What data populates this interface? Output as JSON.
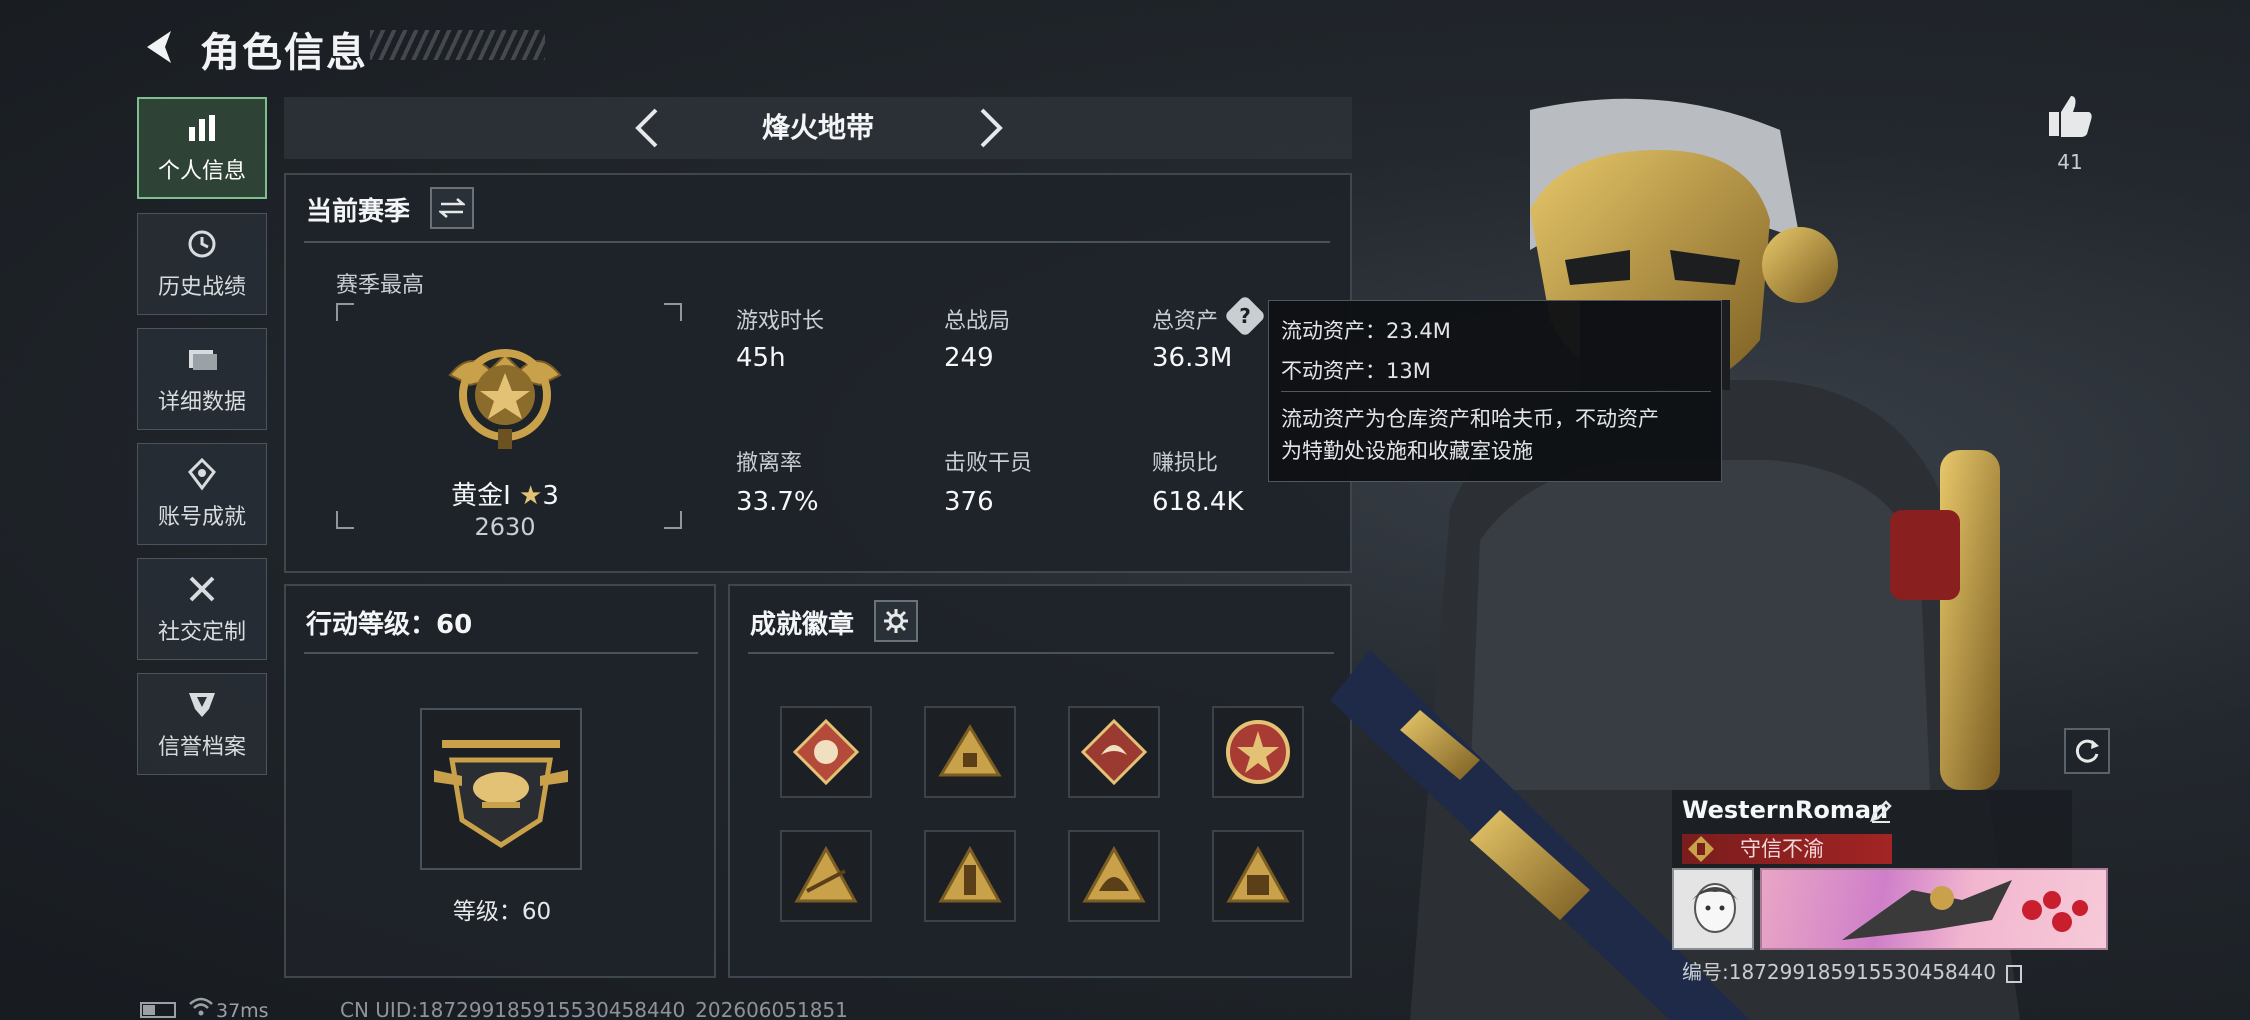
{
  "header": {
    "title": "角色信息"
  },
  "sidebar": {
    "items": [
      {
        "label": "个人信息",
        "icon": "bar-chart-icon",
        "active": true
      },
      {
        "label": "历史战绩",
        "icon": "history-clock-icon",
        "active": false
      },
      {
        "label": "详细数据",
        "icon": "folder-icon",
        "active": false
      },
      {
        "label": "账号成就",
        "icon": "achievement-icon",
        "active": false
      },
      {
        "label": "社交定制",
        "icon": "tools-icon",
        "active": false
      },
      {
        "label": "信誉档案",
        "icon": "shield-icon",
        "active": false
      }
    ]
  },
  "mode": {
    "title": "烽火地带"
  },
  "season": {
    "title": "当前赛季",
    "best_label": "赛季最高",
    "rank_name": "黄金I",
    "rank_stars": "3",
    "rank_points": "2630",
    "stats": [
      {
        "label": "游戏时长",
        "value": "45h"
      },
      {
        "label": "总战局",
        "value": "249"
      },
      {
        "label": "总资产",
        "value": "36.3M"
      },
      {
        "label": "撤离率",
        "value": "33.7%"
      },
      {
        "label": "击败干员",
        "value": "376"
      },
      {
        "label": "赚损比",
        "value": "618.4K"
      }
    ]
  },
  "tooltip": {
    "liquid": "流动资产：23.4M",
    "fixed": "不动资产：13M",
    "desc_line1": "流动资产为仓库资产和哈夫币，不动资产",
    "desc_line2": "为特勤处设施和收藏室设施"
  },
  "level": {
    "title": "行动等级：60",
    "label": "等级：60"
  },
  "badges": {
    "title": "成就徽章",
    "count": 8
  },
  "player": {
    "likes": "41",
    "name": "WesternRoman",
    "reputation": "守信不渝",
    "id": "编号:1872991859155304584​40"
  },
  "status": {
    "ping": "37ms",
    "uid": "CN UID:18729918591553045844​0_202606051851"
  },
  "colors": {
    "accent_green": "#7fbf8f",
    "gold": "#c9a14a",
    "reputation_red": "#a32424"
  }
}
